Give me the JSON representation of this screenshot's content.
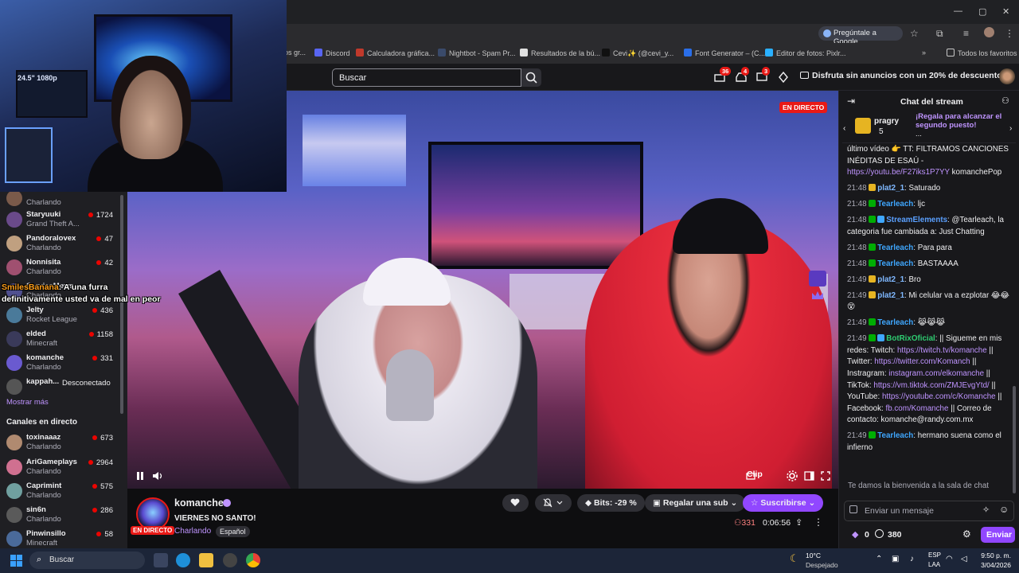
{
  "browser": {
    "google_pill": "Pregúntale a Google",
    "bookmarks": [
      {
        "label": "os gr...",
        "color": "#4a4a4f"
      },
      {
        "label": "Discord",
        "color": "#5865f2"
      },
      {
        "label": "Calculadora gráfica...",
        "color": "#c0392b"
      },
      {
        "label": "Nightbot - Spam Pr...",
        "color": "#3a4a6a"
      },
      {
        "label": "Resultados de la bú...",
        "color": "#e0e0e0"
      },
      {
        "label": "Cevi✨ (@cevi_y...",
        "color": "#111111"
      },
      {
        "label": "Font Generator – (C...",
        "color": "#2a6ee8"
      },
      {
        "label": "Editor de fotos: Pixlr...",
        "color": "#2ab0ff"
      }
    ],
    "all_favorites": "Todos los favoritos"
  },
  "nav": {
    "search_placeholder": "Buscar",
    "badges": [
      "36",
      "4",
      "3"
    ],
    "promo": "Disfruta sin anuncios con un 20% de descuento."
  },
  "webcam": {
    "label": "24.5\" 1080p"
  },
  "sidebar": {
    "channels_top": [
      {
        "name": "",
        "game": "Charlando",
        "viewers": "",
        "color": "#7a5a4a"
      },
      {
        "name": "Staryuuki",
        "game": "Grand Theft A...",
        "viewers": "1724",
        "color": "#6a4a8a"
      },
      {
        "name": "Pandoralovex",
        "game": "Charlando",
        "viewers": "47",
        "color": "#c0a080"
      },
      {
        "name": "Nonnisita",
        "game": "Charlando",
        "viewers": "42",
        "color": "#a05070"
      },
      {
        "name": "ServiceMews",
        "game": "Charlando",
        "viewers": "",
        "color": "#505090"
      },
      {
        "name": "Jelty",
        "game": "Rocket League",
        "viewers": "436",
        "color": "#4a7a9a"
      },
      {
        "name": "elded",
        "game": "Minecraft",
        "viewers": "1158",
        "color": "#3a3a5a"
      },
      {
        "name": "komanche",
        "game": "Charlando",
        "viewers": "331",
        "color": "#6a5ad0"
      }
    ],
    "offline": {
      "name": "kappah...",
      "status": "Desconectado"
    },
    "show_more": "Mostrar más",
    "live_channels_title": "Canales en directo",
    "live_channels": [
      {
        "name": "toxinaaaz",
        "game": "Charlando",
        "viewers": "673",
        "color": "#b08a70"
      },
      {
        "name": "AriGameplays",
        "game": "Charlando",
        "viewers": "2964",
        "color": "#d07090"
      },
      {
        "name": "Caprimint",
        "game": "Charlando",
        "viewers": "575",
        "color": "#70a0a0"
      },
      {
        "name": "sin6n",
        "game": "Charlando",
        "viewers": "286",
        "color": "#5a5a5a"
      },
      {
        "name": "Pinwinsillo",
        "game": "Minecraft",
        "viewers": "58",
        "color": "#4a6a9a"
      }
    ]
  },
  "overlay_chat": {
    "user": "SmilesBanana",
    "text": ": A una furra definitivamente usted va de mal en peor"
  },
  "video": {
    "live": "EN DIRECTO",
    "clip": "Clip"
  },
  "channel": {
    "name": "komanche",
    "live": "EN DIRECTO",
    "title": "VIERNES NO SANTO!",
    "category": "Charlando",
    "language": "Español",
    "bits": "Bits: -29 %",
    "gift_sub": "Regalar una sub",
    "subscribe": "Suscribirse",
    "viewers": "331",
    "uptime": "0:06:56"
  },
  "chat": {
    "title": "Chat del stream",
    "gift": {
      "user": "pragry",
      "count": "5",
      "text": "¡Regala para alcanzar el segundo puesto!",
      "more": "..."
    },
    "top_partial": "último vídeo 👉 TT: FILTRAMOS CANCIONES INÉDITAS DE ESAÚ - ",
    "top_link": "https://youtu.be/F27iks1P7YY",
    "top_tail": " komanchePop",
    "messages": [
      {
        "ts": "21:48",
        "user": "plat2_1",
        "color": "#7fb8ff",
        "text": ": Saturado"
      },
      {
        "ts": "21:48",
        "user": "Tearleach",
        "color": "#3fa7ff",
        "text": ": ljc"
      },
      {
        "ts": "21:48",
        "user": "StreamElements",
        "color": "#5aa0ff",
        "text": ": @Tearleach, la categoria fue cambiada a: Just Chatting"
      },
      {
        "ts": "21:48",
        "user": "Tearleach",
        "color": "#3fa7ff",
        "text": ": Para para"
      },
      {
        "ts": "21:48",
        "user": "Tearleach",
        "color": "#3fa7ff",
        "text": ": BASTAAAA"
      },
      {
        "ts": "21:49",
        "user": "plat2_1",
        "color": "#7fb8ff",
        "text": ": Bro"
      },
      {
        "ts": "21:49",
        "user": "plat2_1",
        "color": "#7fb8ff",
        "text": ": Mi celular va a ezplotar 😂😂😵"
      },
      {
        "ts": "21:49",
        "user": "Tearleach",
        "color": "#3fa7ff",
        "text": ": 😹😹😹"
      }
    ],
    "bot": {
      "ts": "21:49",
      "user": "BotRixOficial",
      "color": "#2ecc71",
      "t1": ": || Sigueme en mis redes: Twitch: ",
      "l1": "https://twitch.tv/komanche",
      "t2": " || Twitter: ",
      "l2": "https://twitter.com/Komanch",
      "t3": " || Instragram: ",
      "l3": "instagram.com/elkomanche",
      "t4": " || TikTok: ",
      "l4": "https://vm.tiktok.com/ZMJEvgYtd/",
      "t5": " || YouTube: ",
      "l5": "https://youtube.com/c/Komanche",
      "t6": " || Facebook: ",
      "l6": "fb.com/Komanche",
      "t7": " || Correo de contacto: komanche@randy.com.mx"
    },
    "last": {
      "ts": "21:49",
      "user": "Tearleach",
      "color": "#3fa7ff",
      "text": ": hermano suena como el infierno"
    },
    "welcome": "Te damos la bienvenida a la sala de chat",
    "input_placeholder": "Enviar un mensaje",
    "bits_count": "0",
    "points": "380",
    "send": "Enviar"
  },
  "taskbar": {
    "search": "Buscar",
    "temp": "10°C",
    "condition": "Despejado",
    "lang1": "ESP",
    "lang2": "LAA",
    "time": "9:50 p. m.",
    "date": "3/04/2026"
  }
}
